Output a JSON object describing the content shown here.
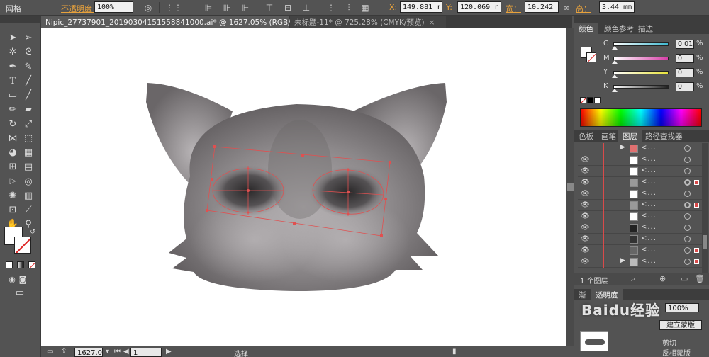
{
  "menu": {
    "label": "网格"
  },
  "control_bar": {
    "opacity_label": "不透明度：",
    "opacity_value": "100%",
    "x_label": "X:",
    "x_value": "149.881 r",
    "y_label": "Y:",
    "y_value": "120.069 r",
    "w_label": "宽：",
    "w_value": "10.242 mm",
    "h_label": "高：",
    "h_value": "3.44 mm"
  },
  "tabs": [
    {
      "label": "Nipic_27737901_20190304151558841000.ai* @ 1627.05% (RGB/预览)",
      "close": "×"
    },
    {
      "label": "未标题-11* @ 725.28% (CMYK/预览)",
      "close": "×"
    }
  ],
  "color_panel": {
    "tabs": [
      "颜色",
      "颜色参考",
      "描边"
    ],
    "sliders": [
      {
        "key": "C",
        "value": "0.01",
        "unit": "%",
        "color": "#3fb8d0"
      },
      {
        "key": "M",
        "value": "0",
        "unit": "%",
        "color": "#d63fa8"
      },
      {
        "key": "Y",
        "value": "0",
        "unit": "%",
        "color": "#e8e23a"
      },
      {
        "key": "K",
        "value": "0",
        "unit": "%",
        "color": "#222222"
      }
    ]
  },
  "layers_panel": {
    "tabs": [
      "色板",
      "画笔",
      "图层",
      "路径查找器"
    ],
    "row_name": "<...",
    "footer": "1 个图层"
  },
  "bottom_panel": {
    "tabs": [
      "渐",
      "透明度"
    ],
    "opacity": "100%",
    "option_1": "建立蒙版",
    "option_2": "剪切",
    "option_3": "反相蒙版"
  },
  "watermark": {
    "text": "Baidu经验"
  },
  "status_bar": {
    "zoom": "1627.0",
    "page": "1",
    "tool": "选择"
  },
  "colors": {
    "selection": "#e05050",
    "ui_dark": "#535353",
    "accent_orange": "#e8a23c"
  }
}
